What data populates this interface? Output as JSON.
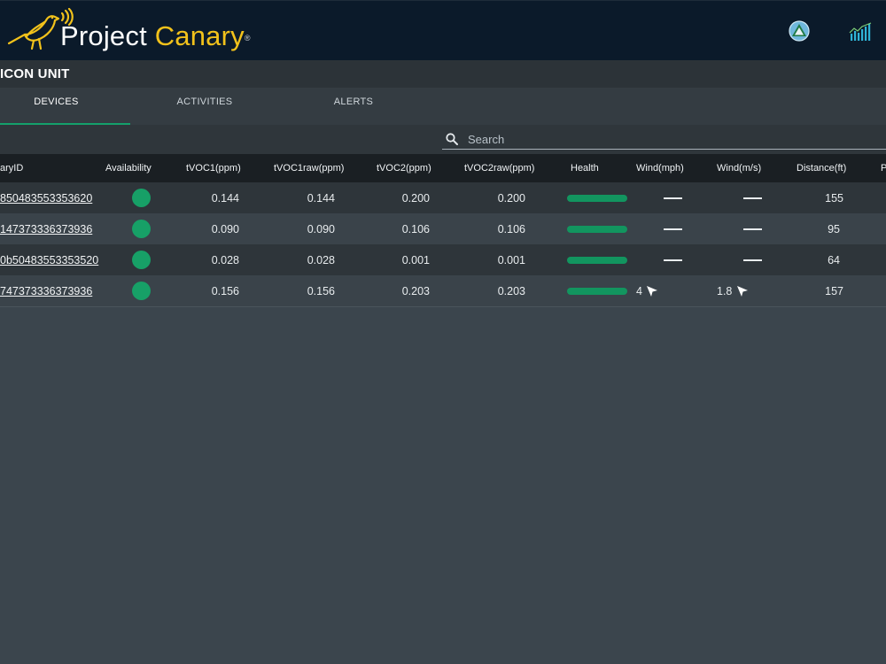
{
  "header": {
    "brand_word1": "Project",
    "brand_word2": "Canary",
    "brand_mark": "®",
    "icons": [
      "canary-logo-icon",
      "map-icon",
      "signal-chart-icon"
    ],
    "colors": {
      "navbar": "#0b1a2a",
      "brand_yellow": "#f2c21b",
      "accent_green": "#14a06b"
    }
  },
  "unit": {
    "title": "ICON UNIT"
  },
  "tabs": [
    {
      "label": "DEVICES",
      "active": true
    },
    {
      "label": "ACTIVITIES",
      "active": false
    },
    {
      "label": "ALERTS",
      "active": false
    }
  ],
  "search": {
    "placeholder": "Search",
    "value": ""
  },
  "table": {
    "columns": [
      "aryID",
      "Availability",
      "tVOC1(ppm)",
      "tVOC1raw(ppm)",
      "tVOC2(ppm)",
      "tVOC2raw(ppm)",
      "Health",
      "Wind(mph)",
      "Wind(m/s)",
      "Distance(ft)",
      "P"
    ],
    "rows": [
      {
        "id": "850483553353620",
        "tvoc1": "0.144",
        "tvoc1raw": "0.144",
        "tvoc2": "0.200",
        "tvoc2raw": "0.200",
        "wind_mph": "—",
        "wind_ms": "—",
        "distance": "155",
        "availability": "available",
        "health": 1.0
      },
      {
        "id": "147373336373936",
        "tvoc1": "0.090",
        "tvoc1raw": "0.090",
        "tvoc2": "0.106",
        "tvoc2raw": "0.106",
        "wind_mph": "—",
        "wind_ms": "—",
        "distance": "95",
        "availability": "available",
        "health": 1.0
      },
      {
        "id": "0b50483553353520",
        "tvoc1": "0.028",
        "tvoc1raw": "0.028",
        "tvoc2": "0.001",
        "tvoc2raw": "0.001",
        "wind_mph": "—",
        "wind_ms": "—",
        "distance": "64",
        "availability": "available",
        "health": 1.0
      },
      {
        "id": "747373336373936",
        "tvoc1": "0.156",
        "tvoc1raw": "0.156",
        "tvoc2": "0.203",
        "tvoc2raw": "0.203",
        "wind_mph": "4",
        "wind_ms": "1.8",
        "distance": "157",
        "availability": "available",
        "health": 1.0,
        "wind_direction_icon": "wind-arrow-icon"
      }
    ]
  }
}
